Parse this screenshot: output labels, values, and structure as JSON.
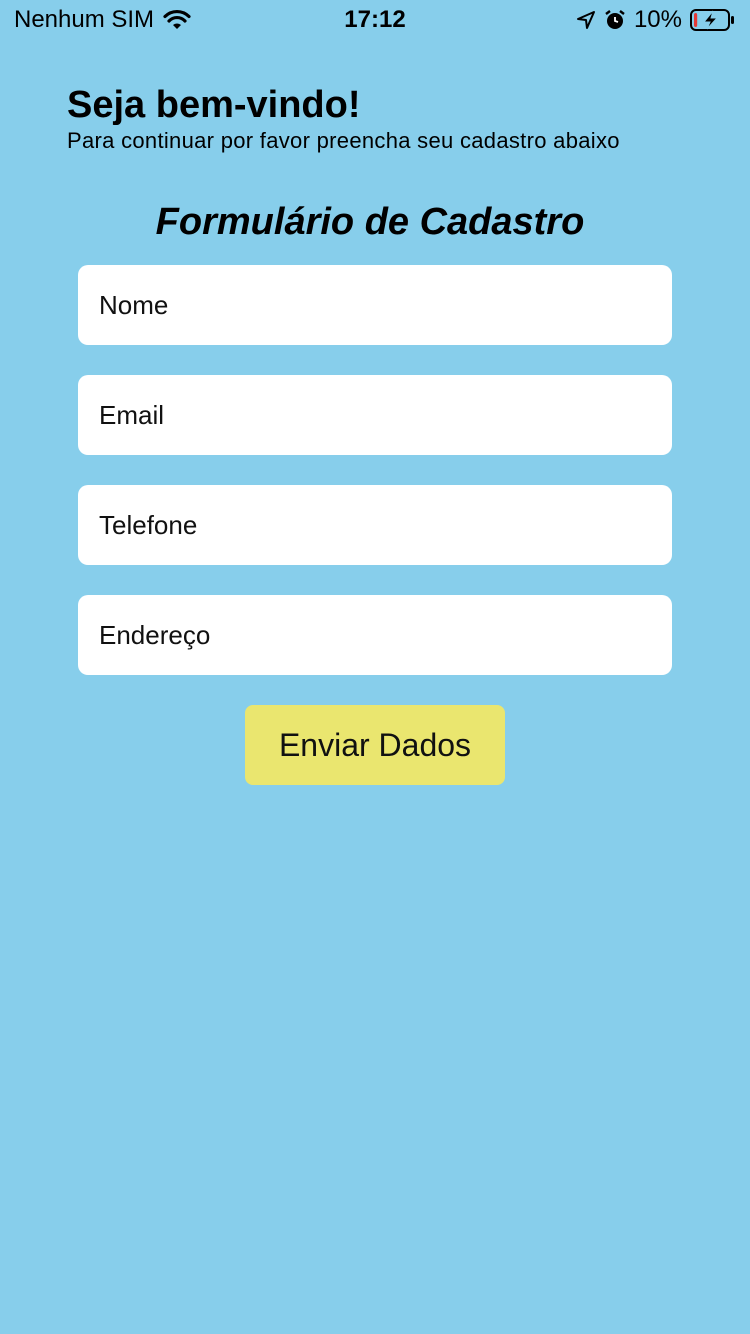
{
  "status_bar": {
    "carrier": "Nenhum SIM",
    "time": "17:12",
    "battery_percent": "10%",
    "battery_level": 0.1,
    "battery_charging": true,
    "icons": [
      "wifi-icon",
      "location-arrow-icon",
      "alarm-clock-icon",
      "battery-icon",
      "charging-bolt-icon"
    ]
  },
  "header": {
    "title": "Seja bem-vindo!",
    "subtitle": "Para continuar por favor preencha seu cadastro abaixo"
  },
  "form": {
    "title": "Formulário de Cadastro",
    "fields": {
      "nome_placeholder": "Nome",
      "email_placeholder": "Email",
      "telefone_placeholder": "Telefone",
      "endereco_placeholder": "Endereço"
    },
    "submit_label": "Enviar Dados"
  },
  "colors": {
    "background": "#87CEEB",
    "field_background": "#FFFFFF",
    "button_background": "#EAE66F",
    "battery_low": "#E53935"
  }
}
